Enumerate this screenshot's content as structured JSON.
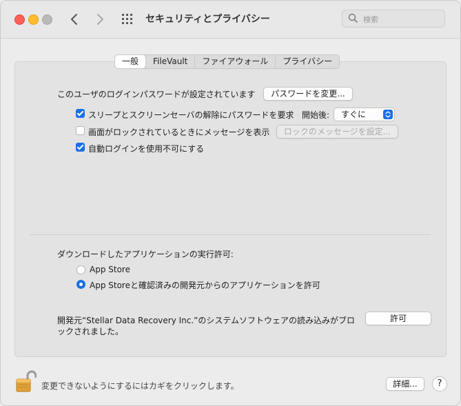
{
  "window": {
    "title": "セキュリティとプライバシー"
  },
  "search": {
    "placeholder": "検索"
  },
  "tabs": [
    {
      "label": "一般",
      "active": true
    },
    {
      "label": "FileVault"
    },
    {
      "label": "ファイアウォール"
    },
    {
      "label": "プライバシー"
    }
  ],
  "general": {
    "password_text": "このユーザのログインパスワードが設定されています",
    "change_password_button": "パスワードを変更...",
    "require_password_label": "スリープとスクリーンセーバの解除にパスワードを要求",
    "require_password_checked": true,
    "start_after_label": "開始後:",
    "start_after_value": "すぐに",
    "lock_message_label": "画面がロックされているときにメッセージを表示",
    "lock_message_checked": false,
    "set_lock_message_button": "ロックのメッセージを設定...",
    "disable_auto_login_label": "自動ログインを使用不可にする",
    "disable_auto_login_checked": true
  },
  "downloads": {
    "heading": "ダウンロードしたアプリケーションの実行許可:",
    "options": [
      {
        "label": "App Store",
        "selected": false
      },
      {
        "label": "App Storeと確認済みの開発元からのアプリケーションを許可",
        "selected": true
      }
    ]
  },
  "blocked": {
    "line1": "開発元“Stellar Data Recovery Inc.”のシステムソフトウェアの読み込みがブロ",
    "line2": "ックされました。",
    "allow_button": "許可"
  },
  "footer": {
    "lock_text": "変更できないようにするにはカギをクリックします。",
    "advanced_button": "詳細...",
    "help_button": "?"
  },
  "colors": {
    "accent": "#1a6fe6",
    "close": "#ff5f57",
    "minimize": "#febc2e",
    "zoom_inactive": "#b9b9b9"
  },
  "icons": [
    "search-icon",
    "chevron-left-icon",
    "chevron-right-icon",
    "grid-icon",
    "lock-icon",
    "checkmark-icon",
    "chevron-updown-icon"
  ]
}
